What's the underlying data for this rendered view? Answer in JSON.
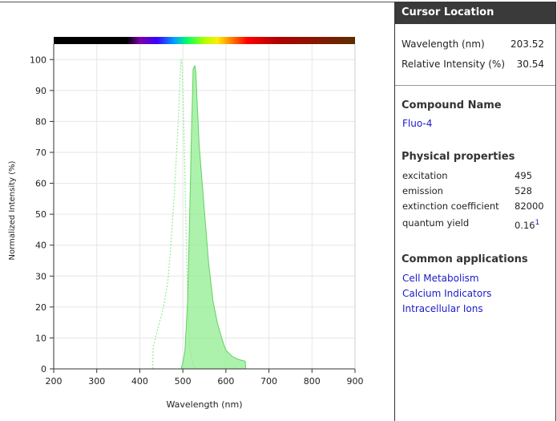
{
  "chart_data": {
    "type": "area",
    "xlabel": "Wavelength (nm)",
    "ylabel": "Normalized Intensity (%)",
    "xlim": [
      200,
      900
    ],
    "ylim": [
      0,
      105
    ],
    "xticks": [
      200,
      300,
      400,
      500,
      600,
      700,
      800,
      900
    ],
    "yticks": [
      0,
      10,
      20,
      30,
      40,
      50,
      60,
      70,
      80,
      90,
      100
    ],
    "grid": true,
    "series": [
      {
        "style": "dashed-outline",
        "color": "#90ee90",
        "points": [
          [
            430,
            0
          ],
          [
            431,
            7
          ],
          [
            440,
            12
          ],
          [
            455,
            20
          ],
          [
            465,
            28
          ],
          [
            470,
            36
          ],
          [
            475,
            46
          ],
          [
            480,
            56
          ],
          [
            484,
            66
          ],
          [
            488,
            76
          ],
          [
            491,
            86
          ],
          [
            494,
            96
          ],
          [
            496,
            100
          ],
          [
            498,
            98
          ],
          [
            501,
            86
          ],
          [
            504,
            68
          ],
          [
            507,
            48
          ],
          [
            510,
            30
          ],
          [
            513,
            16
          ],
          [
            517,
            6
          ],
          [
            524,
            1
          ],
          [
            535,
            0
          ]
        ]
      },
      {
        "style": "filled-area",
        "color": "#90ee90",
        "points": [
          [
            496,
            0
          ],
          [
            500,
            2
          ],
          [
            505,
            6
          ],
          [
            511,
            22
          ],
          [
            516,
            50
          ],
          [
            520,
            76
          ],
          [
            524,
            97
          ],
          [
            528,
            98
          ],
          [
            530,
            96
          ],
          [
            534,
            84
          ],
          [
            538,
            72
          ],
          [
            545,
            60
          ],
          [
            553,
            46
          ],
          [
            560,
            34
          ],
          [
            570,
            22
          ],
          [
            580,
            15
          ],
          [
            590,
            10
          ],
          [
            600,
            6
          ],
          [
            615,
            4
          ],
          [
            630,
            3
          ],
          [
            645,
            2.5
          ],
          [
            646,
            0
          ]
        ]
      }
    ]
  },
  "spectrum_bar": {
    "stops": [
      {
        "nm": 200,
        "color": "#000000"
      },
      {
        "nm": 370,
        "color": "#000000"
      },
      {
        "nm": 400,
        "color": "#7a00a8"
      },
      {
        "nm": 440,
        "color": "#3a00ff"
      },
      {
        "nm": 480,
        "color": "#00a0ff"
      },
      {
        "nm": 510,
        "color": "#00ff66"
      },
      {
        "nm": 550,
        "color": "#b0ff00"
      },
      {
        "nm": 580,
        "color": "#ffee00"
      },
      {
        "nm": 610,
        "color": "#ff8800"
      },
      {
        "nm": 650,
        "color": "#ff0000"
      },
      {
        "nm": 720,
        "color": "#b00000"
      },
      {
        "nm": 900,
        "color": "#5c2e00"
      }
    ]
  },
  "cursor": {
    "header": "Cursor Location",
    "wavelength_label": "Wavelength (nm)",
    "wavelength_value": "203.52",
    "intensity_label": "Relative Intensity (%)",
    "intensity_value": "30.54"
  },
  "compound": {
    "header": "Compound Name",
    "name": "Fluo-4"
  },
  "physical": {
    "header": "Physical properties",
    "excitation_label": "excitation",
    "excitation_value": "495",
    "emission_label": "emission",
    "emission_value": "528",
    "extinction_label": "extinction coefficient",
    "extinction_value": "82000",
    "qy_label": "quantum yield",
    "qy_value": "0.16",
    "qy_ref": "1"
  },
  "applications": {
    "header": "Common applications",
    "items": [
      "Cell Metabolism",
      "Calcium Indicators",
      "Intracellular Ions"
    ]
  }
}
